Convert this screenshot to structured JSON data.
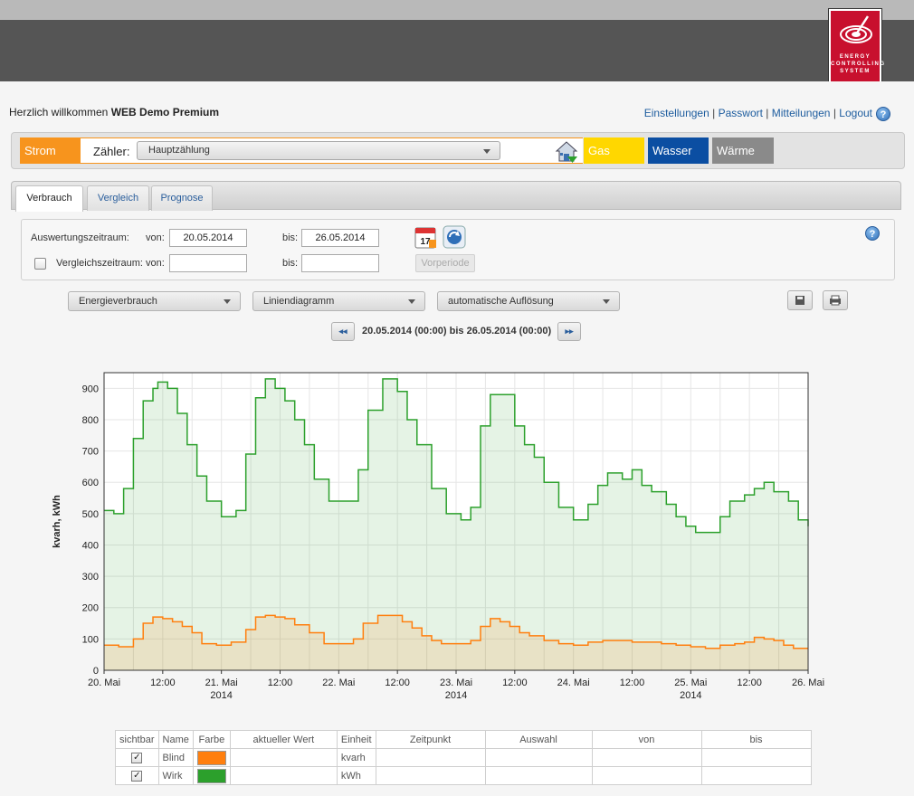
{
  "header": {
    "logo_lines": [
      "ENERGY",
      "CONTROLLING",
      "SYSTEM"
    ]
  },
  "welcome": {
    "prefix": "Herzlich willkommen",
    "user": "WEB Demo Premium"
  },
  "toplinks": {
    "settings": "Einstellungen",
    "password": "Passwort",
    "messages": "Mitteilungen",
    "logout": "Logout",
    "separator": "|"
  },
  "medium_bar": {
    "strom": "Strom",
    "meter_label": "Zähler:",
    "meter_value": "Hauptzählung",
    "gas": "Gas",
    "wasser": "Wasser",
    "waerme": "Wärme"
  },
  "tabs": [
    "Verbrauch",
    "Vergleich",
    "Prognose"
  ],
  "filter": {
    "evaluation_label": "Auswertungszeitraum:",
    "from_label": "von:",
    "to_label": "bis:",
    "from_value": "20.05.2014",
    "to_value": "26.05.2014",
    "compare_label": "Vergleichszeitraum:",
    "compare_from": "",
    "compare_to": "",
    "prev_period": "Vorperiode",
    "calendar_day": "17"
  },
  "options": {
    "measure": "Energieverbrauch",
    "chart_type": "Liniendiagramm",
    "resolution": "automatische Auflösung"
  },
  "navigation": {
    "prev": "◂◂",
    "next": "▸▸",
    "range": "20.05.2014 (00:00) bis 26.05.2014 (00:00)"
  },
  "chart_data": {
    "type": "area",
    "ylabel": "kvarh, kWh",
    "ylim": [
      0,
      950
    ],
    "yticks": [
      0,
      100,
      200,
      300,
      400,
      500,
      600,
      700,
      800,
      900
    ],
    "x_hours": [
      0,
      144
    ],
    "xticks": [
      {
        "h": 0,
        "label": [
          "20. Mai"
        ]
      },
      {
        "h": 12,
        "label": [
          "12:00"
        ]
      },
      {
        "h": 24,
        "label": [
          "21. Mai",
          "2014"
        ]
      },
      {
        "h": 36,
        "label": [
          "12:00"
        ]
      },
      {
        "h": 48,
        "label": [
          "22. Mai"
        ]
      },
      {
        "h": 60,
        "label": [
          "12:00"
        ]
      },
      {
        "h": 72,
        "label": [
          "23. Mai",
          "2014"
        ]
      },
      {
        "h": 84,
        "label": [
          "12:00"
        ]
      },
      {
        "h": 96,
        "label": [
          "24. Mai"
        ]
      },
      {
        "h": 108,
        "label": [
          "12:00"
        ]
      },
      {
        "h": 120,
        "label": [
          "25. Mai",
          "2014"
        ]
      },
      {
        "h": 132,
        "label": [
          "12:00"
        ]
      },
      {
        "h": 144,
        "label": [
          "26. Mai"
        ]
      }
    ],
    "series": [
      {
        "name": "Wirk",
        "color": "#2ca02c",
        "values": [
          [
            0,
            510
          ],
          [
            2,
            500
          ],
          [
            4,
            580
          ],
          [
            6,
            740
          ],
          [
            8,
            860
          ],
          [
            10,
            900
          ],
          [
            11,
            920
          ],
          [
            13,
            900
          ],
          [
            15,
            820
          ],
          [
            17,
            720
          ],
          [
            19,
            620
          ],
          [
            21,
            540
          ],
          [
            24,
            490
          ],
          [
            27,
            510
          ],
          [
            29,
            690
          ],
          [
            31,
            870
          ],
          [
            33,
            930
          ],
          [
            35,
            900
          ],
          [
            37,
            860
          ],
          [
            39,
            800
          ],
          [
            41,
            720
          ],
          [
            43,
            610
          ],
          [
            46,
            540
          ],
          [
            49,
            540
          ],
          [
            52,
            640
          ],
          [
            54,
            830
          ],
          [
            57,
            930
          ],
          [
            60,
            890
          ],
          [
            62,
            800
          ],
          [
            64,
            720
          ],
          [
            67,
            580
          ],
          [
            70,
            500
          ],
          [
            73,
            480
          ],
          [
            75,
            520
          ],
          [
            77,
            780
          ],
          [
            79,
            880
          ],
          [
            82,
            880
          ],
          [
            84,
            780
          ],
          [
            86,
            720
          ],
          [
            88,
            680
          ],
          [
            90,
            600
          ],
          [
            93,
            520
          ],
          [
            96,
            480
          ],
          [
            99,
            530
          ],
          [
            101,
            590
          ],
          [
            103,
            630
          ],
          [
            106,
            610
          ],
          [
            108,
            640
          ],
          [
            110,
            590
          ],
          [
            112,
            570
          ],
          [
            115,
            530
          ],
          [
            117,
            490
          ],
          [
            119,
            460
          ],
          [
            121,
            440
          ],
          [
            124,
            440
          ],
          [
            126,
            490
          ],
          [
            128,
            540
          ],
          [
            131,
            560
          ],
          [
            133,
            580
          ],
          [
            135,
            600
          ],
          [
            137,
            570
          ],
          [
            140,
            540
          ],
          [
            142,
            480
          ],
          [
            144,
            460
          ]
        ]
      },
      {
        "name": "Blind",
        "color": "#ff7f0e",
        "values": [
          [
            0,
            80
          ],
          [
            3,
            75
          ],
          [
            6,
            100
          ],
          [
            8,
            150
          ],
          [
            10,
            170
          ],
          [
            12,
            165
          ],
          [
            14,
            155
          ],
          [
            16,
            140
          ],
          [
            18,
            120
          ],
          [
            20,
            85
          ],
          [
            23,
            80
          ],
          [
            26,
            90
          ],
          [
            29,
            130
          ],
          [
            31,
            170
          ],
          [
            33,
            175
          ],
          [
            35,
            170
          ],
          [
            37,
            165
          ],
          [
            39,
            145
          ],
          [
            42,
            120
          ],
          [
            45,
            85
          ],
          [
            48,
            85
          ],
          [
            51,
            100
          ],
          [
            53,
            150
          ],
          [
            56,
            175
          ],
          [
            59,
            175
          ],
          [
            61,
            155
          ],
          [
            63,
            135
          ],
          [
            65,
            110
          ],
          [
            67,
            95
          ],
          [
            69,
            85
          ],
          [
            72,
            85
          ],
          [
            75,
            95
          ],
          [
            77,
            140
          ],
          [
            79,
            165
          ],
          [
            81,
            155
          ],
          [
            83,
            140
          ],
          [
            85,
            120
          ],
          [
            87,
            110
          ],
          [
            90,
            95
          ],
          [
            93,
            85
          ],
          [
            96,
            80
          ],
          [
            99,
            90
          ],
          [
            102,
            95
          ],
          [
            105,
            95
          ],
          [
            108,
            90
          ],
          [
            111,
            90
          ],
          [
            114,
            85
          ],
          [
            117,
            80
          ],
          [
            120,
            75
          ],
          [
            123,
            70
          ],
          [
            126,
            80
          ],
          [
            129,
            85
          ],
          [
            131,
            90
          ],
          [
            133,
            105
          ],
          [
            135,
            100
          ],
          [
            137,
            95
          ],
          [
            139,
            80
          ],
          [
            141,
            70
          ],
          [
            144,
            70
          ]
        ]
      }
    ]
  },
  "legend_table": {
    "headers": [
      "sichtbar",
      "Name",
      "Farbe",
      "aktueller Wert",
      "Einheit",
      "Zeitpunkt",
      "Auswahl",
      "von",
      "bis"
    ],
    "rows": [
      {
        "name": "Blind",
        "color": "#ff7f0e",
        "unit": "kvarh"
      },
      {
        "name": "Wirk",
        "color": "#2ca02c",
        "unit": "kWh"
      }
    ]
  }
}
